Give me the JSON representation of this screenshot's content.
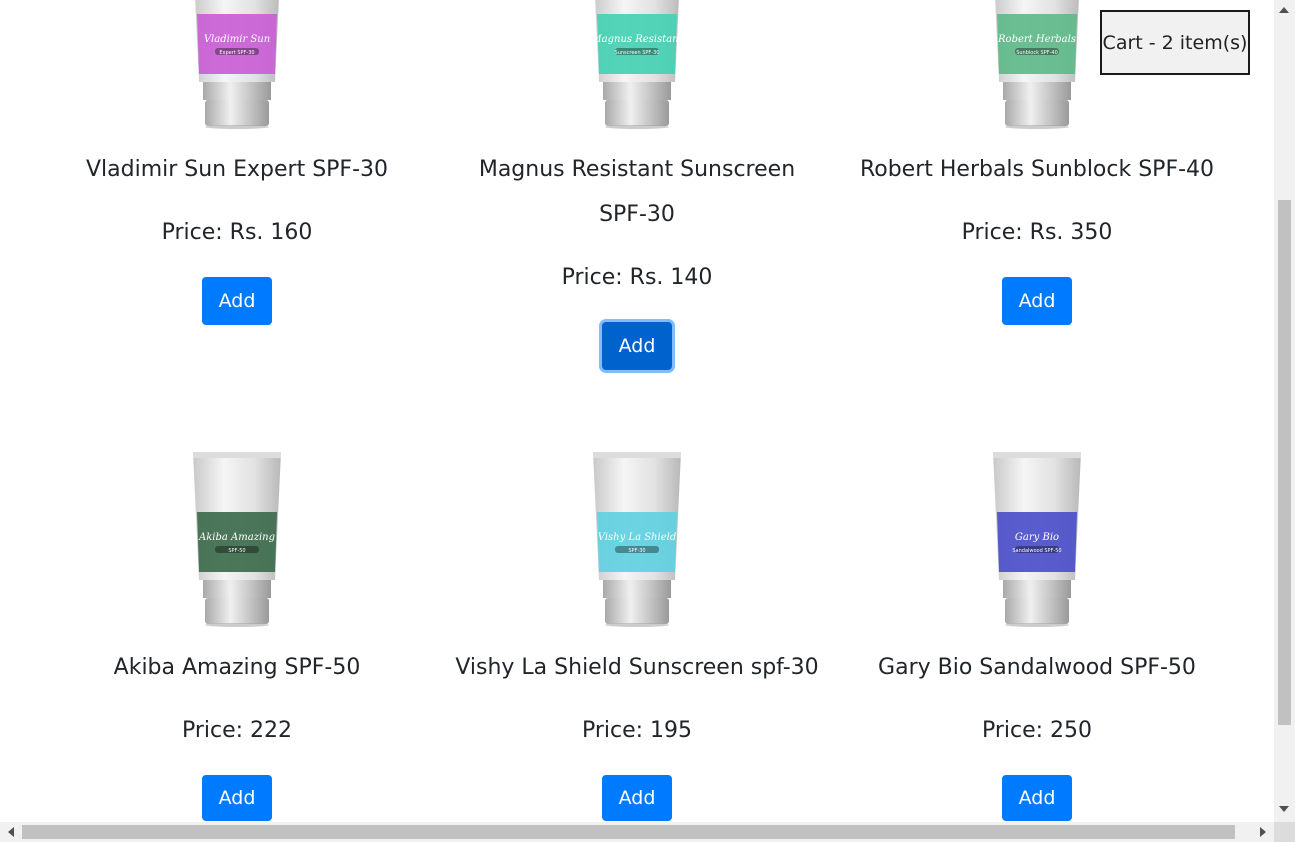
{
  "cart": {
    "label": "Cart - 2 item(s)"
  },
  "products": [
    {
      "name": "Vladimir Sun Expert SPF-30",
      "price": "Price: Rs. 160",
      "button": "Add",
      "label_color": "#c95fd6",
      "tube_brand": "Vladimir Sun",
      "tube_sub": "Expert SPF-30"
    },
    {
      "name": "Magnus Resistant Sunscreen SPF-30",
      "price": "Price: Rs. 140",
      "button": "Add",
      "label_color": "#45d1b3",
      "tube_brand": "Magnus Resistant",
      "tube_sub": "Sunscreen SPF-30"
    },
    {
      "name": "Robert Herbals Sunblock SPF-40",
      "price": "Price: Rs. 350",
      "button": "Add",
      "label_color": "#5fba8a",
      "tube_brand": "Robert Herbals",
      "tube_sub": "Sunblock SPF-40"
    },
    {
      "name": "Akiba Amazing SPF-50",
      "price": "Price: 222",
      "button": "Add",
      "label_color": "#3e6b4c",
      "tube_brand": "Akiba Amazing",
      "tube_sub": "SPF-50"
    },
    {
      "name": "Vishy La Shield Sunscreen spf-30",
      "price": "Price: 195",
      "button": "Add",
      "label_color": "#5fd0e0",
      "tube_brand": "Vishy La Shield",
      "tube_sub": "SPF-30"
    },
    {
      "name": "Gary Bio Sandalwood SPF-50",
      "price": "Price: 250",
      "button": "Add",
      "label_color": "#4b4fc9",
      "tube_brand": "Gary Bio",
      "tube_sub": "Sandalwood SPF-50"
    }
  ],
  "colors": {
    "button": "#007bff",
    "button_focused": "#0062cc"
  }
}
